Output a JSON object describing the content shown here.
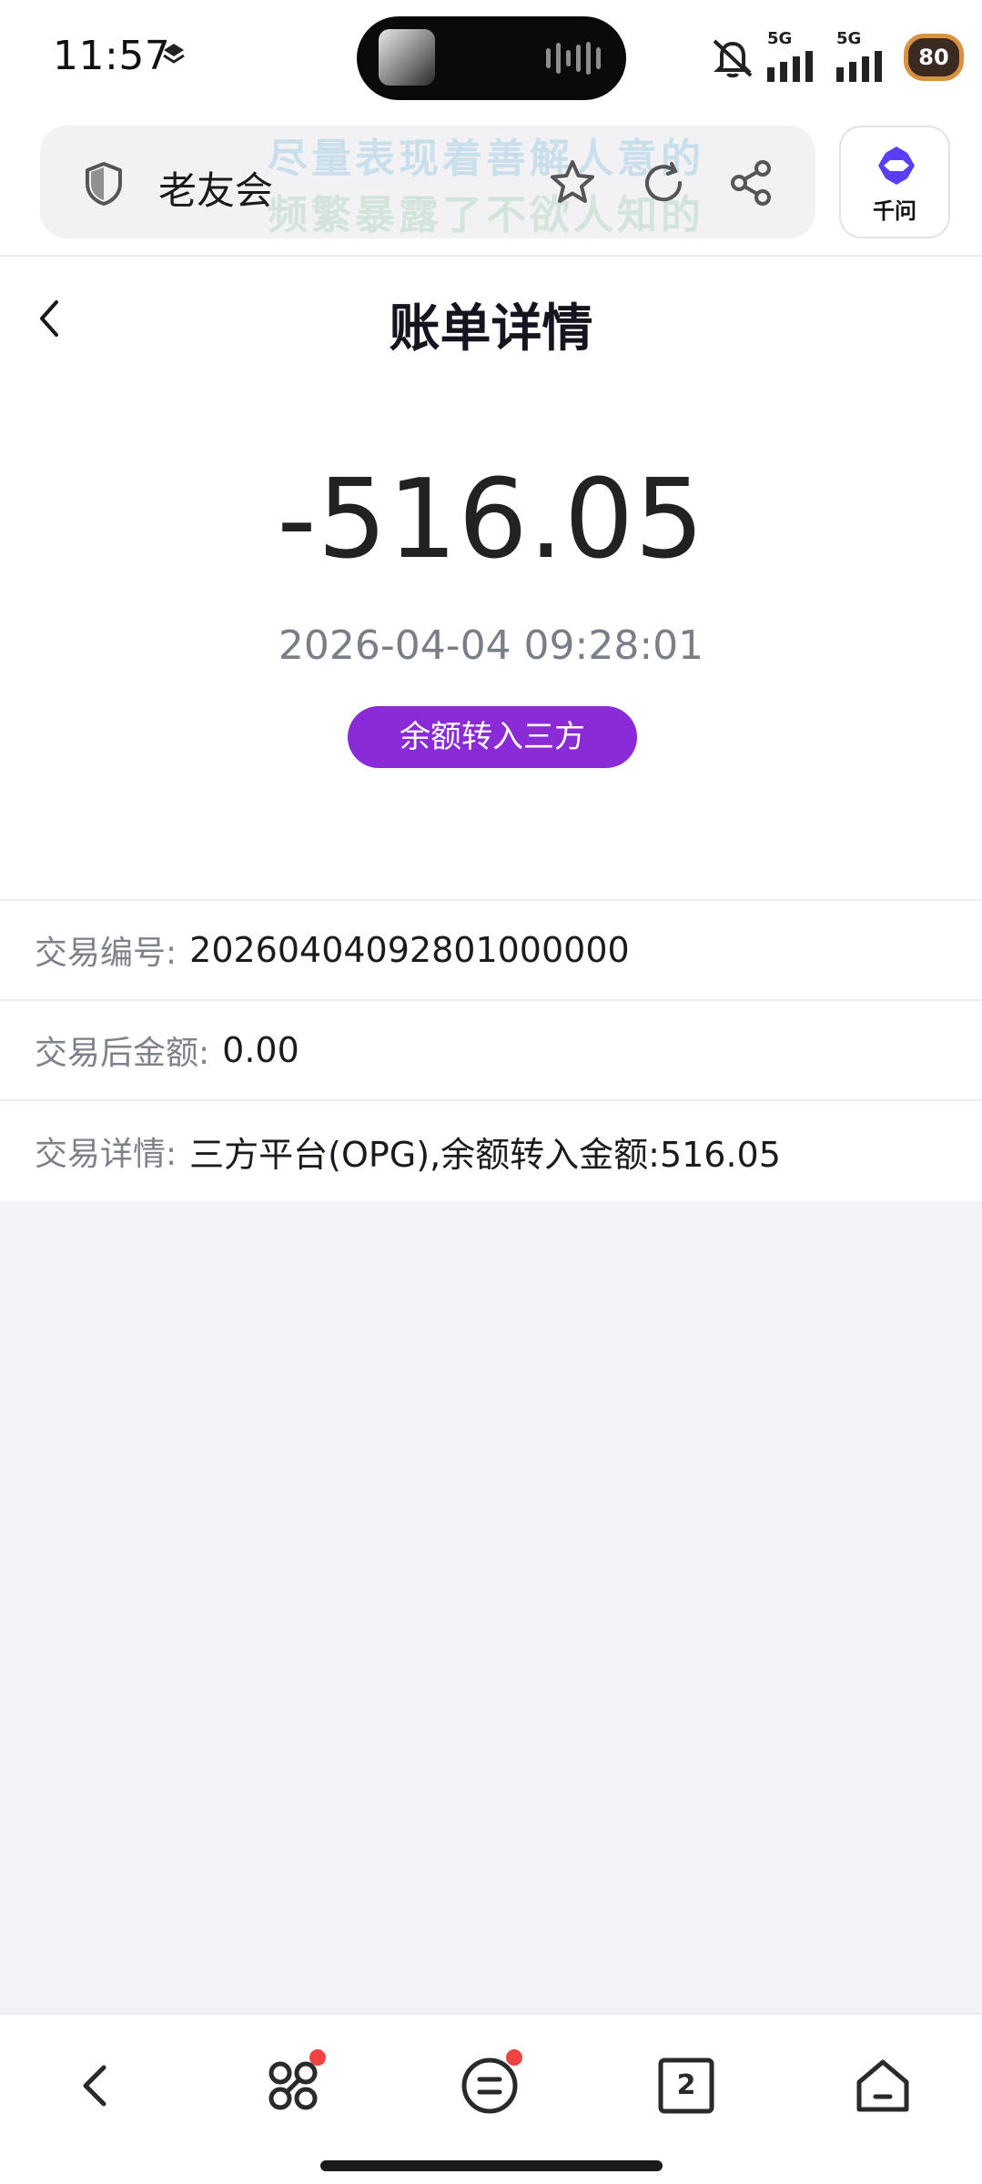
{
  "status_bar": {
    "time": "11:57",
    "network_1": "5G",
    "network_2": "5G",
    "battery": "80",
    "icons": [
      "location-icon",
      "music-thumbnail",
      "audio-wave-icon",
      "mute-icon",
      "signal-icon",
      "signal-icon",
      "battery-icon"
    ]
  },
  "browser": {
    "site_name": "老友会",
    "watermark_line1": "尽量表现着善解人意的",
    "watermark_line2": "频繁暴露了不欲人知的",
    "icons": [
      "shield-icon",
      "star-icon",
      "reload-icon",
      "share-icon"
    ],
    "assistant_label": "千问",
    "assistant_color": "#5b3df5"
  },
  "header": {
    "title": "账单详情",
    "back_icon": "chevron-left-icon"
  },
  "bill": {
    "amount": "-516.05",
    "datetime": "2026-04-04 09:28:01",
    "type_badge": "余额转入三方",
    "badge_color": "#8b2bd8"
  },
  "details": [
    {
      "label": "交易编号:",
      "value": "20260404092801000000"
    },
    {
      "label": "交易后金额:",
      "value": "0.00"
    },
    {
      "label": "交易详情:",
      "value": "三方平台(OPG),余额转入金额:516.05"
    }
  ],
  "bottom_nav": {
    "tab_count": "2",
    "items": [
      "back-icon",
      "apps-icon",
      "menu-icon",
      "tabs-icon",
      "home-icon"
    ],
    "badge_color": "#ef4444"
  }
}
